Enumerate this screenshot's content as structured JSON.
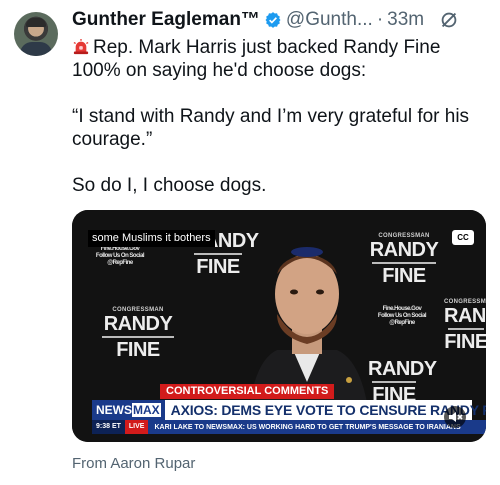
{
  "tweet": {
    "author_name": "Gunther Eagleman™",
    "handle": "@Gunth...",
    "separator": "·",
    "time": "33m",
    "paragraph1": "Rep. Mark Harris just backed Randy Fine 100% on saying he'd choose dogs:",
    "paragraph2": "“I stand with Randy and I’m very grateful for his courage.”",
    "paragraph3": "So do I,  I choose dogs.",
    "from_credit": "From Aaron Rupar"
  },
  "video": {
    "caption": "some Muslims it bothers",
    "cc_label": "CC",
    "sign_small": "CONGRESSMAN",
    "sign_big1": "RANDY",
    "sign_big2": "FINE",
    "sign_web": "Fine.House.Gov",
    "sign_follow": "Follow Us On Social",
    "sign_handle": "@RepFine",
    "banner_red": "CONTROVERSIAL COMMENTS",
    "logo_a": "NEWS",
    "logo_b": "MAX",
    "headline": "AXIOS: DEMS EYE VOTE TO CENSURE RANDY FINE",
    "ticker_time": "9:38 ET",
    "ticker_live": "LIVE",
    "ticker_text": "KARI LAKE TO NEWSMAX: US WORKING HARD TO GET TRUMP'S MESSAGE TO IRANIANS"
  },
  "colors": {
    "verified": "#1d9bf0",
    "newsmax_blue": "#1a3a8a",
    "banner_red": "#d21b1b",
    "muted_text": "#536471"
  },
  "icons": [
    "verified-badge-icon",
    "grok-icon",
    "siren-icon",
    "cc-icon",
    "mute-icon"
  ]
}
